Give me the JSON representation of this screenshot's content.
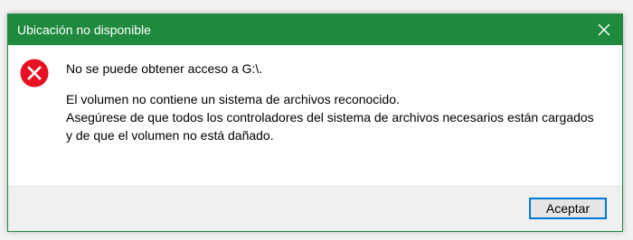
{
  "dialog": {
    "title": "Ubicación no disponible",
    "close_icon": "close-icon",
    "error_icon": "error-icon",
    "main_instruction": "No se puede obtener acceso a G:\\.",
    "details": [
      "El volumen no contiene un sistema de archivos reconocido.",
      "Asegúrese de que todos los controladores del sistema de archivos necesarios están cargados",
      "y de que el volumen no está dañado."
    ],
    "ok_label": "Aceptar"
  },
  "colors": {
    "titlebar": "#1f8a3e",
    "error_circle": "#e81123",
    "button_border": "#0078d7"
  }
}
